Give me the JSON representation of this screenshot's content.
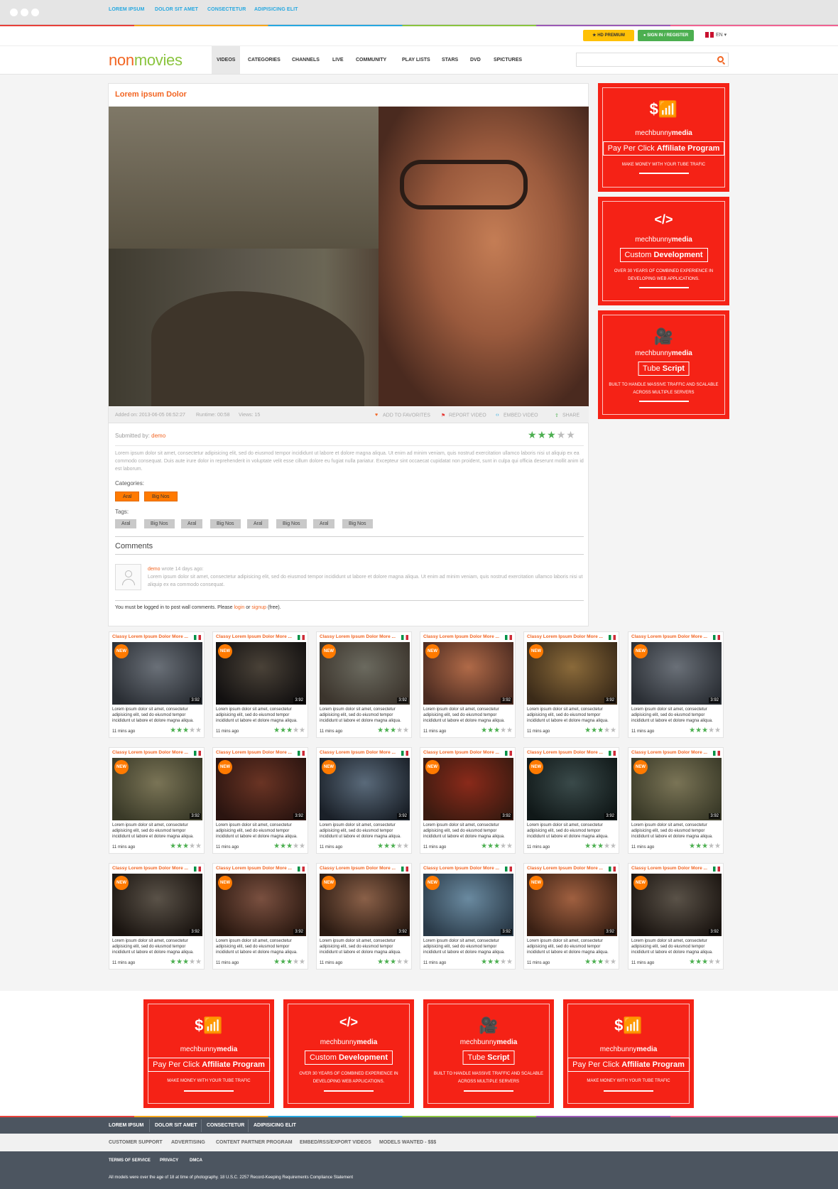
{
  "topbar": {
    "links": [
      "LOREM IPSUM",
      "DOLOR SIT AMET",
      "CONSECTETUR",
      "ADIPISICING ELIT"
    ],
    "hd_premium": "HD PREMIUM",
    "signin": "SIGN IN / REGISTER",
    "lang": "EN ▾"
  },
  "logo": {
    "part1": "non",
    "part2": "movies"
  },
  "nav": [
    "VIDEOS",
    "CATEGORIES",
    "CHANNELS",
    "LIVE",
    "COMMUNITY",
    "PLAY LISTS",
    "STARS",
    "DVD",
    "SPICTURES"
  ],
  "search": {
    "placeholder": ""
  },
  "video": {
    "title": "Lorem ipsum Dolor",
    "added": "Added on: 2013-06-05 06:52:27",
    "runtime": "Runtime: 00:58",
    "views": "Views: 15",
    "actions": [
      "ADD TO FAVORITES",
      "REPORT VIDEO",
      "EMBED VIDEO",
      "SHARE"
    ],
    "submitted_label": "Submitted by: ",
    "submitted_user": "demo",
    "rating": 3,
    "description": "Lorem ipsum dolor sit amet, consectetur adipisicing elit, sed do eiusmod tempor incididunt ut labore et dolore magna aliqua. Ut enim ad minim veniam, quis nostrud exercitation ullamco laboris nisi ut aliquip ex ea commodo consequat. Duis aute irure dolor in reprehenderit in voluptate velit esse cillum dolore eu fugiat nulla pariatur. Excepteur sint occaecat cupidatat non proident, sunt in culpa qui officia deserunt mollit anim id est laborum.",
    "categories_label": "Categories:",
    "categories": [
      "Aral",
      "Big Nos"
    ],
    "tags_label": "Tags:",
    "tags": [
      "Aral",
      "Big Nos",
      "Aral",
      "Big Nos",
      "Aral",
      "Big Nos",
      "Aral",
      "Big Nos"
    ]
  },
  "comments": {
    "heading": "Comments",
    "user": "demo",
    "when": " wrote 14 days ago:",
    "text": "Lorem ipsum dolor sit amet, consectetur adipisicing elit, sed do eiusmod tempor incididunt ut labore et dolore magna aliqua. Ut enim ad minim veniam, quis nostrud exercitation ullamco laboris nisi ut aliquip ex ea commodo consequat.",
    "login_pre": "You must be logged in to post wall comments. Please ",
    "login": "login",
    "or": " or ",
    "signup": "signup",
    "login_post": " (free)."
  },
  "ads": {
    "brand_a": "mechbunny",
    "brand_b": "media",
    "affiliate": {
      "pre": "Pay Per Click ",
      "bold": "Affiliate Program",
      "sub": "MAKE MONEY WITH YOUR TUBE TRAFIC"
    },
    "dev": {
      "pre": "Custom ",
      "bold": "Development",
      "sub": "OVER 30 YEARS OF COMBINED EXPERIENCE IN DEVELOPING WEB APPLICATIONS."
    },
    "tube": {
      "pre": "Tube ",
      "bold": "Script",
      "sub": "BUILT TO HANDLE MASSIVE TRAFFIC AND SCALABLE ACROSS MULTIPLE SERVERS"
    }
  },
  "cards": {
    "title": "Classy Lorem Ipsum Dolor More ...",
    "badge": "NEW",
    "duration": "3:92",
    "desc": "Lorem ipsum dolor sit amet, consectetur adipisicing elit, sed do eiusmod tempor incididunt ut labore et dolore magna aliqua.",
    "ago": "11 mins ago",
    "rating": 3,
    "thumb_colors": [
      [
        "#6a7078",
        "#2a2e34"
      ],
      [
        "#4a4238",
        "#121010"
      ],
      [
        "#6b6a5f",
        "#3b342c"
      ],
      [
        "#b06a48",
        "#4a2a20"
      ],
      [
        "#8a6a3a",
        "#3a2a18"
      ],
      [
        "#6a7078",
        "#2a2e34"
      ],
      [
        "#7a7456",
        "#3a3a28"
      ],
      [
        "#6a3424",
        "#2a1410"
      ],
      [
        "#5a6a7a",
        "#1a2028"
      ],
      [
        "#8a2a1a",
        "#3a1a10"
      ],
      [
        "#3a4a4a",
        "#101818"
      ],
      [
        "#7a7456",
        "#3a3a28"
      ],
      [
        "#5a5248",
        "#1a1410"
      ],
      [
        "#7a5040",
        "#2a1810"
      ],
      [
        "#8a6048",
        "#2a1a12"
      ],
      [
        "#6a8aa0",
        "#2a3a48"
      ],
      [
        "#a06040",
        "#3a2014"
      ],
      [
        "#5a5248",
        "#1a1410"
      ]
    ]
  },
  "footer": {
    "row1": [
      "LOREM IPSUM",
      "DOLOR SIT AMET",
      "CONSECTETUR",
      "ADIPISICING ELIT"
    ],
    "row2": [
      "CUSTOMER SUPPORT",
      "ADVERTISING",
      "CONTENT PARTNER PROGRAM",
      "EMBED/RSS/EXPORT VIDEOS",
      "MODELS WANTED - $$$"
    ],
    "row3": [
      "TERMS OF SERVICE",
      "PRIVACY",
      "DMCA"
    ],
    "compliance": "All models were over the age of 18 at time of photography. 18 U.S.C. 2257 Record-Keeping Requirements Compliance Statement"
  },
  "colors": {
    "accent": "#f26522",
    "green": "#4caf50",
    "ad_red": "#f52216",
    "footer": "#4c5560"
  }
}
